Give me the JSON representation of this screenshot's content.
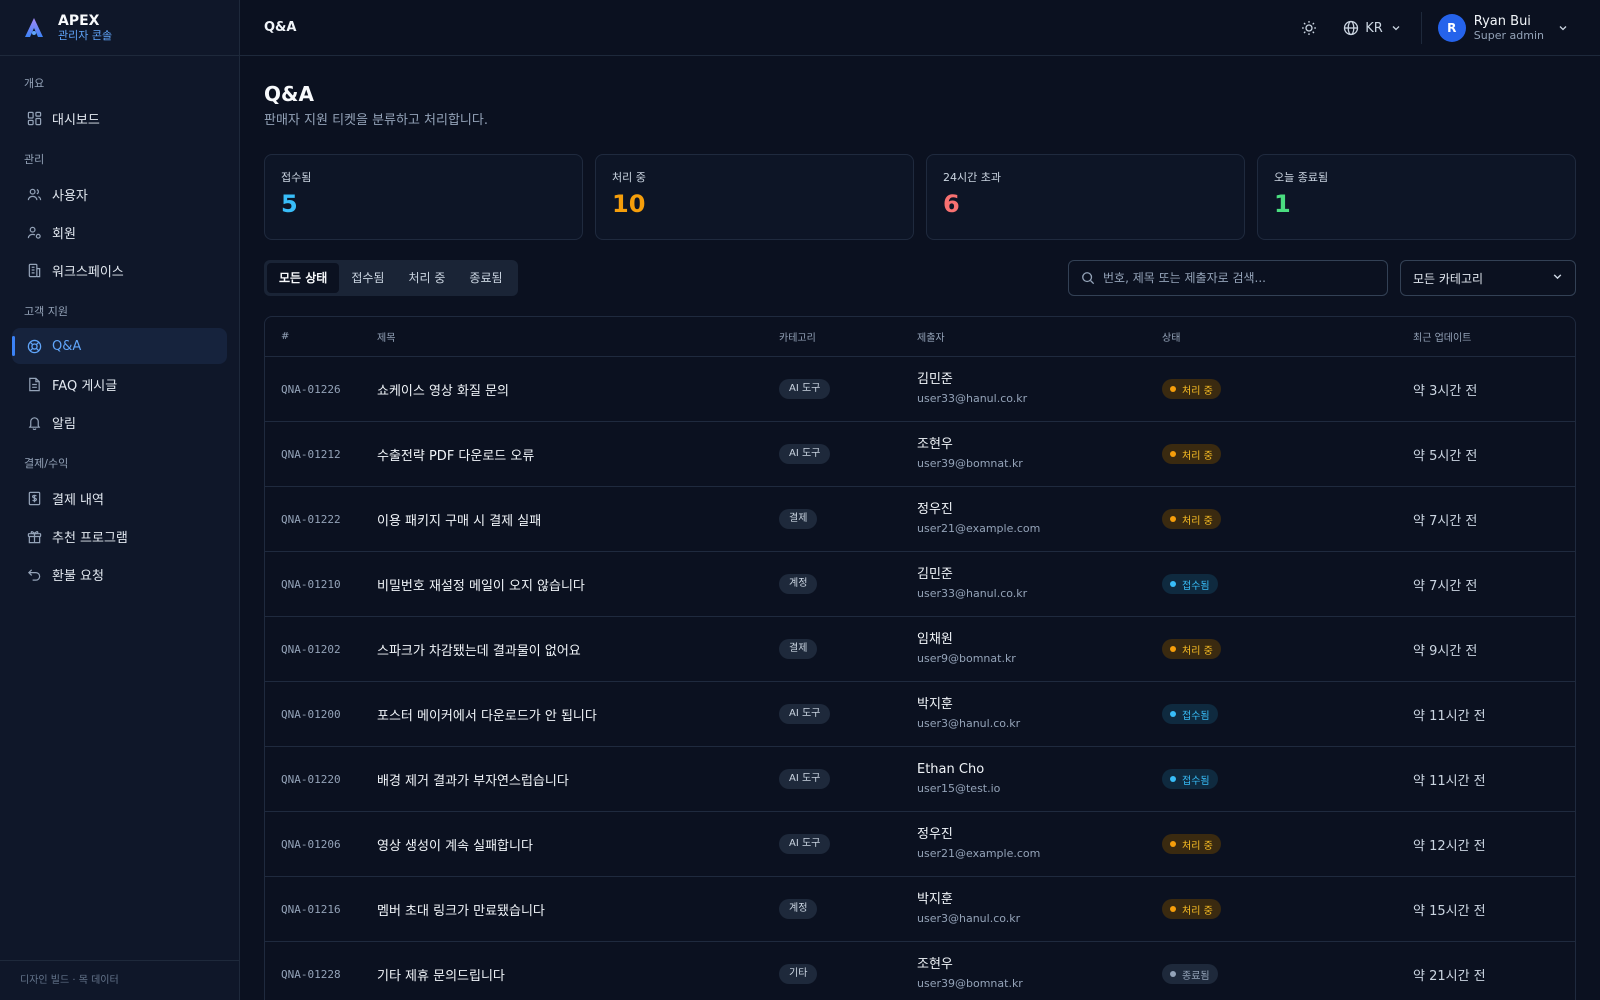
{
  "brand": {
    "name": "APEX",
    "subtitle": "관리자 콘솔"
  },
  "sidebar": {
    "sections": [
      {
        "title": "개요",
        "items": [
          {
            "label": "대시보드",
            "icon": "dashboard-icon"
          }
        ]
      },
      {
        "title": "관리",
        "items": [
          {
            "label": "사용자",
            "icon": "users-icon"
          },
          {
            "label": "회원",
            "icon": "member-icon"
          },
          {
            "label": "워크스페이스",
            "icon": "building-icon"
          }
        ]
      },
      {
        "title": "고객 지원",
        "items": [
          {
            "label": "Q&A",
            "icon": "lifebuoy-icon",
            "active": true
          },
          {
            "label": "FAQ 게시글",
            "icon": "document-icon"
          },
          {
            "label": "알림",
            "icon": "bell-icon"
          }
        ]
      },
      {
        "title": "결제/수익",
        "items": [
          {
            "label": "결제 내역",
            "icon": "receipt-icon"
          },
          {
            "label": "추천 프로그램",
            "icon": "gift-icon"
          },
          {
            "label": "환불 요청",
            "icon": "undo-icon"
          }
        ]
      }
    ],
    "footer": "디자인 빌드 · 목 데이터"
  },
  "topbar": {
    "title": "Q&A",
    "language": "KR",
    "user": {
      "initial": "R",
      "name": "Ryan Bui",
      "role": "Super admin"
    }
  },
  "page": {
    "title": "Q&A",
    "subtitle": "판매자 지원 티켓을 분류하고 처리합니다."
  },
  "stats": [
    {
      "label": "접수됨",
      "value": "5",
      "color": "#38bdf8"
    },
    {
      "label": "처리 중",
      "value": "10",
      "color": "#f59e0b"
    },
    {
      "label": "24시간 초과",
      "value": "6",
      "color": "#f87171"
    },
    {
      "label": "오늘 종료됨",
      "value": "1",
      "color": "#4ade80"
    }
  ],
  "filters": {
    "tabs": [
      "모든 상태",
      "접수됨",
      "처리 중",
      "종료됨"
    ],
    "active_tab": "모든 상태",
    "search_placeholder": "번호, 제목 또는 제출자로 검색...",
    "category_selected": "모든 카테고리"
  },
  "table": {
    "columns": [
      "#",
      "제목",
      "카테고리",
      "제출자",
      "상태",
      "최근 업데이트"
    ],
    "rows": [
      {
        "id": "QNA-01226",
        "title": "쇼케이스 영상 화질 문의",
        "category": "AI 도구",
        "name": "김민준",
        "email": "user33@hanul.co.kr",
        "status": "처리 중",
        "status_type": "proc",
        "updated": "약 3시간 전"
      },
      {
        "id": "QNA-01212",
        "title": "수출전략 PDF 다운로드 오류",
        "category": "AI 도구",
        "name": "조현우",
        "email": "user39@bomnat.kr",
        "status": "처리 중",
        "status_type": "proc",
        "updated": "약 5시간 전"
      },
      {
        "id": "QNA-01222",
        "title": "이용 패키지 구매 시 결제 실패",
        "category": "결제",
        "name": "정우진",
        "email": "user21@example.com",
        "status": "처리 중",
        "status_type": "proc",
        "updated": "약 7시간 전"
      },
      {
        "id": "QNA-01210",
        "title": "비밀번호 재설정 메일이 오지 않습니다",
        "category": "계정",
        "name": "김민준",
        "email": "user33@hanul.co.kr",
        "status": "접수됨",
        "status_type": "recv",
        "updated": "약 7시간 전"
      },
      {
        "id": "QNA-01202",
        "title": "스파크가 차감됐는데 결과물이 없어요",
        "category": "결제",
        "name": "임채원",
        "email": "user9@bomnat.kr",
        "status": "처리 중",
        "status_type": "proc",
        "updated": "약 9시간 전"
      },
      {
        "id": "QNA-01200",
        "title": "포스터 메이커에서 다운로드가 안 됩니다",
        "category": "AI 도구",
        "name": "박지훈",
        "email": "user3@hanul.co.kr",
        "status": "접수됨",
        "status_type": "recv",
        "updated": "약 11시간 전"
      },
      {
        "id": "QNA-01220",
        "title": "배경 제거 결과가 부자연스럽습니다",
        "category": "AI 도구",
        "name": "Ethan Cho",
        "email": "user15@test.io",
        "status": "접수됨",
        "status_type": "recv",
        "updated": "약 11시간 전"
      },
      {
        "id": "QNA-01206",
        "title": "영상 생성이 계속 실패합니다",
        "category": "AI 도구",
        "name": "정우진",
        "email": "user21@example.com",
        "status": "처리 중",
        "status_type": "proc",
        "updated": "약 12시간 전"
      },
      {
        "id": "QNA-01216",
        "title": "멤버 초대 링크가 만료됐습니다",
        "category": "계정",
        "name": "박지훈",
        "email": "user3@hanul.co.kr",
        "status": "처리 중",
        "status_type": "proc",
        "updated": "약 15시간 전"
      },
      {
        "id": "QNA-01228",
        "title": "기타 제휴 문의드립니다",
        "category": "기타",
        "name": "조현우",
        "email": "user39@bomnat.kr",
        "status": "종료됨",
        "status_type": "done",
        "updated": "약 21시간 전"
      }
    ]
  }
}
